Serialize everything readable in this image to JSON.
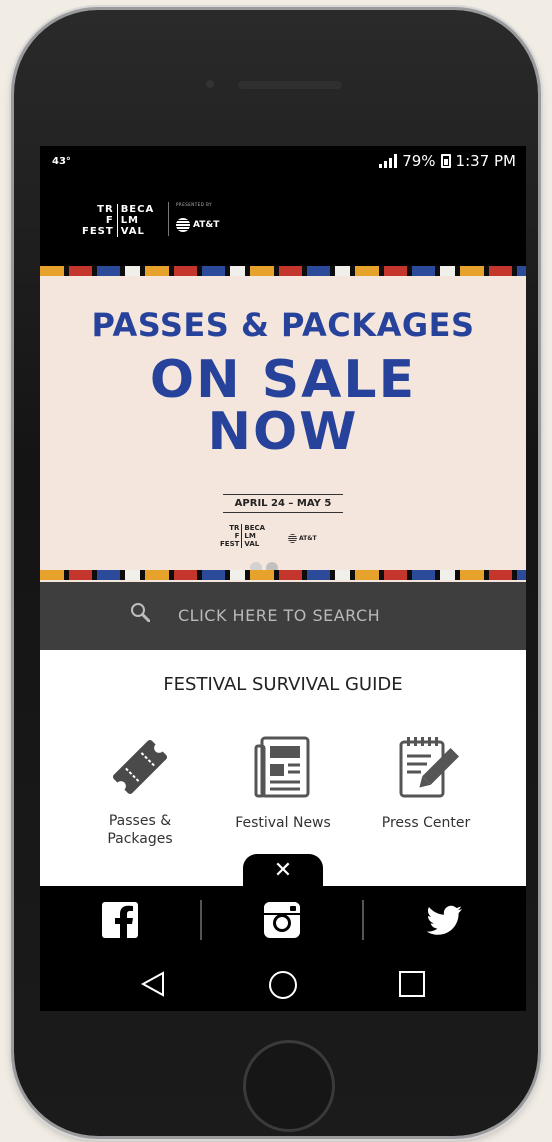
{
  "status_bar": {
    "temperature": "43°",
    "battery": "79%",
    "time": "1:37 PM"
  },
  "header": {
    "logo_lines_left": [
      "TR",
      "F",
      "FEST"
    ],
    "logo_lines_right": [
      "BECA",
      "LM",
      "VAL"
    ],
    "presented_by": "PRESENTED BY",
    "sponsor": "AT&T"
  },
  "banner": {
    "title": "PASSES & PACKAGES",
    "headline_line1": "ON SALE",
    "headline_line2": "NOW",
    "dates": "APRIL 24 – MAY 5",
    "sponsor": "AT&T",
    "slide_count": 2,
    "active_slide": 2
  },
  "search": {
    "placeholder": "CLICK HERE TO SEARCH"
  },
  "guide": {
    "title": "FESTIVAL SURVIVAL GUIDE",
    "items": [
      {
        "line1": "Passes &",
        "line2": "Packages",
        "icon": "ticket-icon"
      },
      {
        "line1": "Festival News",
        "line2": "",
        "icon": "newspaper-icon"
      },
      {
        "line1": "Press Center",
        "line2": "",
        "icon": "notepad-pencil-icon"
      }
    ]
  },
  "social": {
    "close_glyph": "✕",
    "icons": [
      "facebook-icon",
      "instagram-icon",
      "twitter-icon"
    ]
  },
  "colors": {
    "banner_blue": "#27429a",
    "banner_bg": "#f5e6dd",
    "search_bg": "#3e3e3e"
  }
}
